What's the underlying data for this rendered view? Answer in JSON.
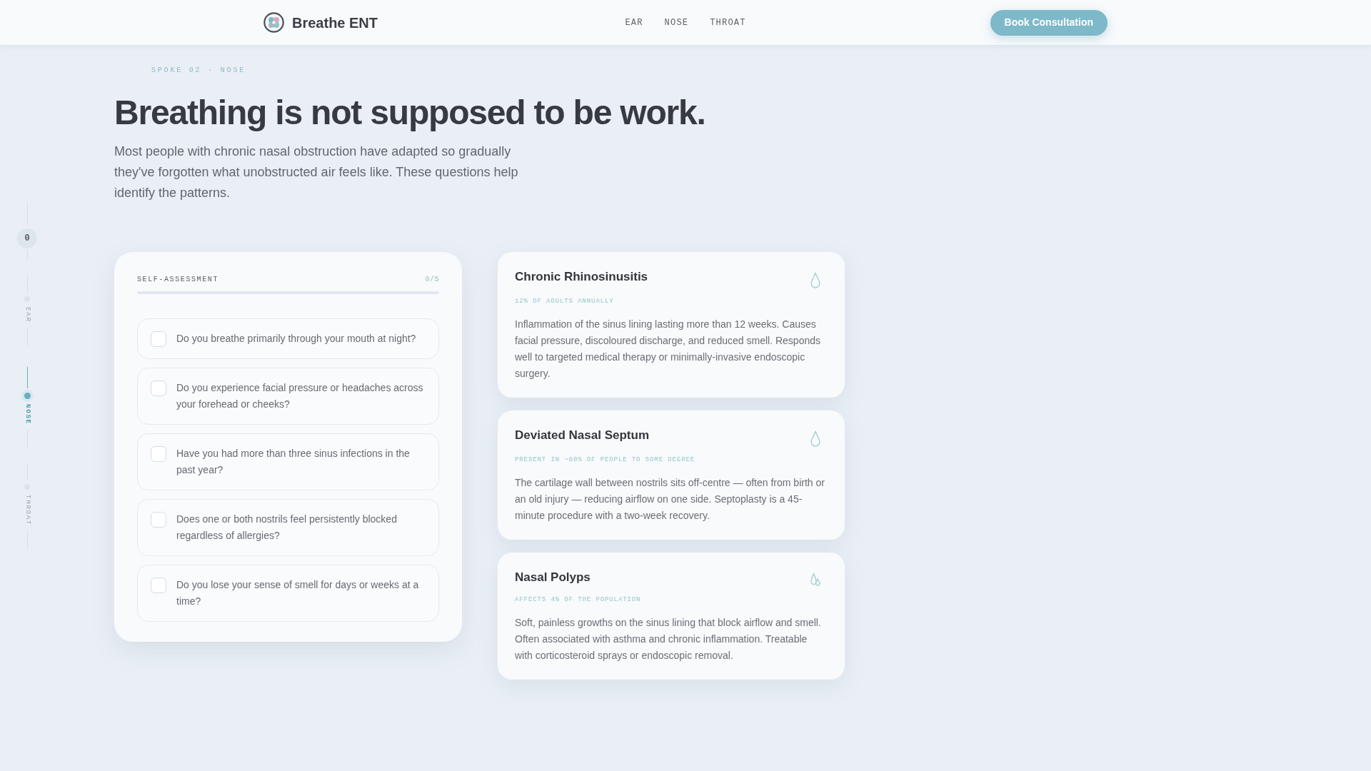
{
  "header": {
    "brand": "Breathe ENT",
    "nav": [
      {
        "label": "EAR"
      },
      {
        "label": "NOSE"
      },
      {
        "label": "THROAT"
      }
    ],
    "cta": "Book Consultation"
  },
  "rail": {
    "counter": "0",
    "items": [
      {
        "label": "EAR",
        "selected": false
      },
      {
        "label": "NOSE",
        "selected": true
      },
      {
        "label": "THROAT",
        "selected": false
      }
    ]
  },
  "hero": {
    "eyebrow": "SPOKE 02 · NOSE",
    "title": "Breathing is not supposed to be work.",
    "intro": "Most people with chronic nasal obstruction have adapted so gradually they've forgotten what unobstructed air feels like. These questions help identify the patterns."
  },
  "assessment": {
    "label": "SELF-ASSESSMENT",
    "count": "0/5",
    "questions": [
      {
        "text": "Do you breathe primarily through your mouth at night?",
        "checked": false
      },
      {
        "text": "Do you experience facial pressure or headaches across your forehead or cheeks?",
        "checked": false
      },
      {
        "text": "Have you had more than three sinus infections in the past year?",
        "checked": false
      },
      {
        "text": "Does one or both nostrils feel persistently blocked regardless of allergies?",
        "checked": false
      },
      {
        "text": "Do you lose your sense of smell for days or weeks at a time?",
        "checked": false
      }
    ]
  },
  "conditions": [
    {
      "title": "Chronic Rhinosinusitis",
      "stat": "12% OF ADULTS ANNUALLY",
      "description": "Inflammation of the sinus lining lasting more than 12 weeks. Causes facial pressure, discoloured discharge, and reduced smell. Responds well to targeted medical therapy or minimally-invasive endoscopic surgery.",
      "kind": "drop"
    },
    {
      "title": "Deviated Nasal Septum",
      "stat": "PRESENT IN ~80% OF PEOPLE TO SOME DEGREE",
      "description": "The cartilage wall between nostrils sits off-centre — often from birth or an old injury — reducing airflow on one side. Septoplasty is a 45-minute procedure with a two-week recovery.",
      "kind": "drop"
    },
    {
      "title": "Nasal Polyps",
      "stat": "AFFECTS 4% OF THE POPULATION",
      "description": "Soft, painless growths on the sinus lining that block airflow and smell. Often associated with asthma and chronic inflammation. Treatable with corticosteroid sprays or endoscopic removal.",
      "kind": "polyps"
    }
  ]
}
